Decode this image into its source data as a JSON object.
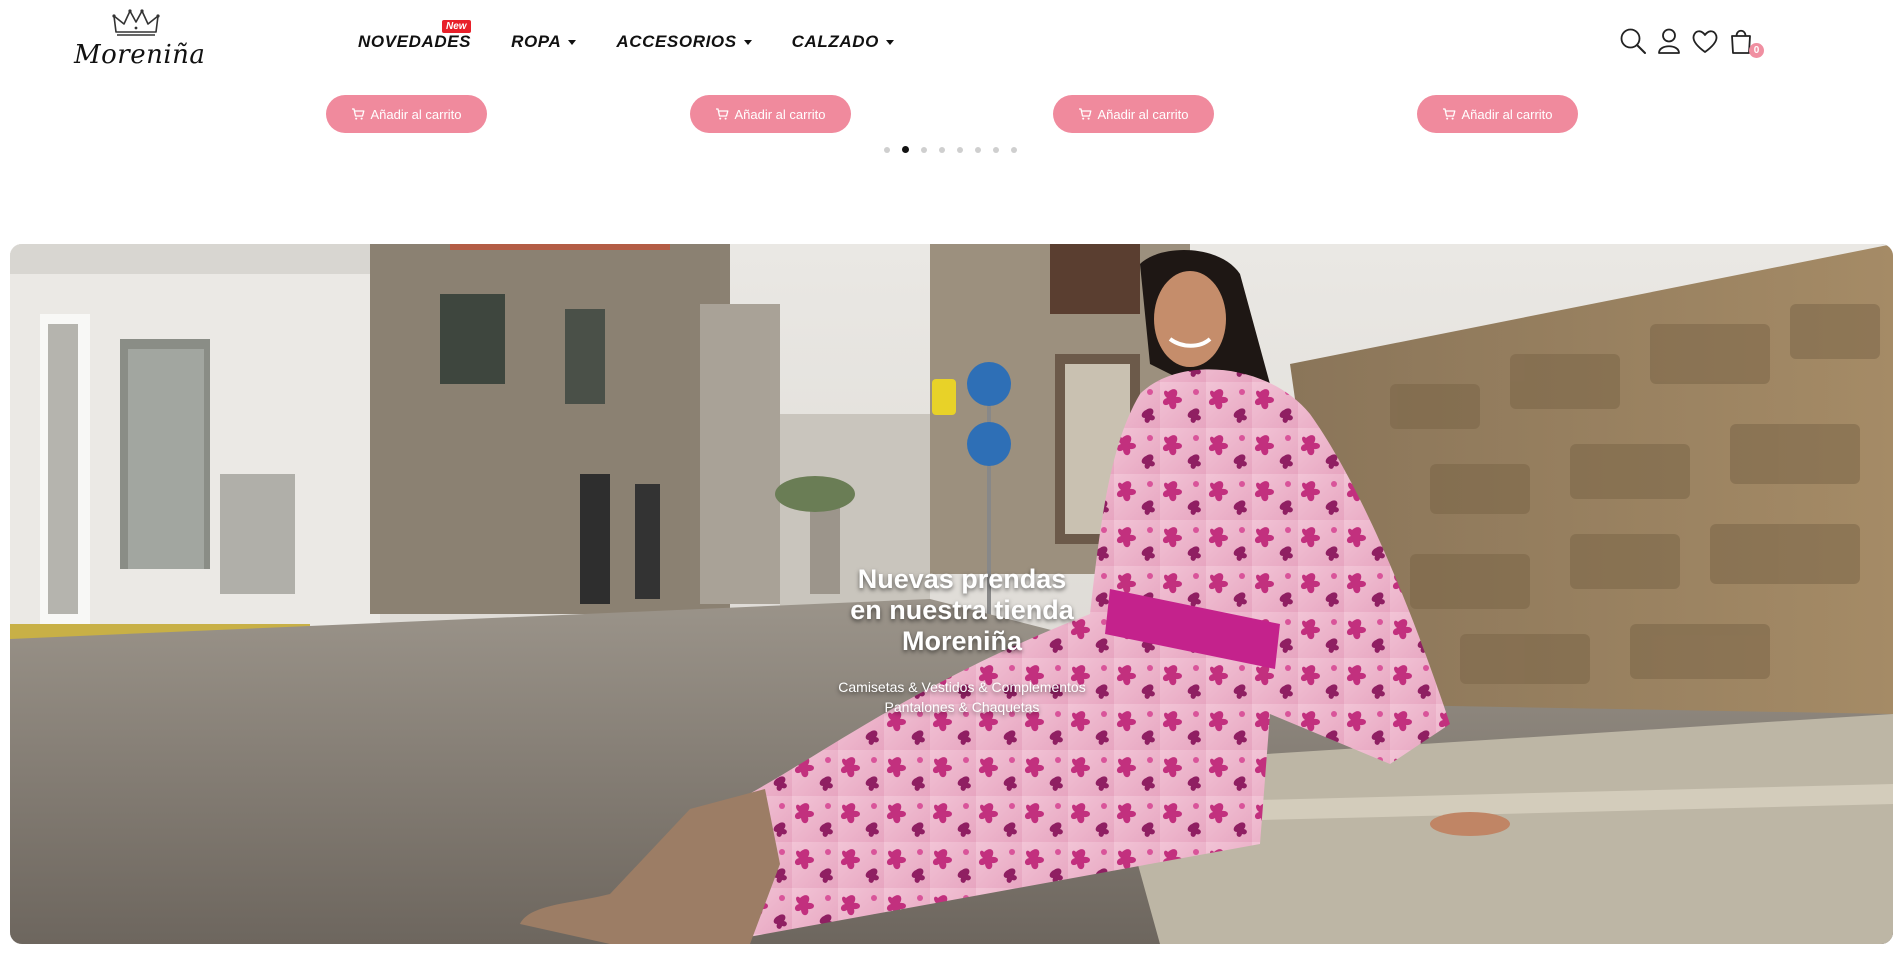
{
  "brand": {
    "name": "Moreniña"
  },
  "nav": {
    "items": [
      {
        "label": "NOVEDADES",
        "badge": "New",
        "has_dropdown": false
      },
      {
        "label": "ROPA",
        "has_dropdown": true
      },
      {
        "label": "ACCESORIOS",
        "has_dropdown": true
      },
      {
        "label": "CALZADO",
        "has_dropdown": true
      }
    ]
  },
  "header_icons": [
    "search-icon",
    "user-icon",
    "heart-icon",
    "shopping-bag-icon"
  ],
  "cart": {
    "count": "0"
  },
  "carousel": {
    "buttons": [
      {
        "label": "Añadir al carrito"
      },
      {
        "label": "Añadir al carrito"
      },
      {
        "label": "Añadir al carrito"
      },
      {
        "label": "Añadir al carrito"
      }
    ],
    "dot_count": 8,
    "active_dot": 1
  },
  "hero": {
    "title_line1": "Nuevas prendas",
    "title_line2": "en nuestra tienda",
    "title_line3": "Moreniña",
    "subtitle_line1": "Camisetas & Vestidos & Complementos",
    "subtitle_line2": "Pantalones & Chaquetas"
  },
  "colors": {
    "accent_pink": "#f08a9d",
    "badge_red": "#e8202a",
    "text_dark": "#111111"
  }
}
